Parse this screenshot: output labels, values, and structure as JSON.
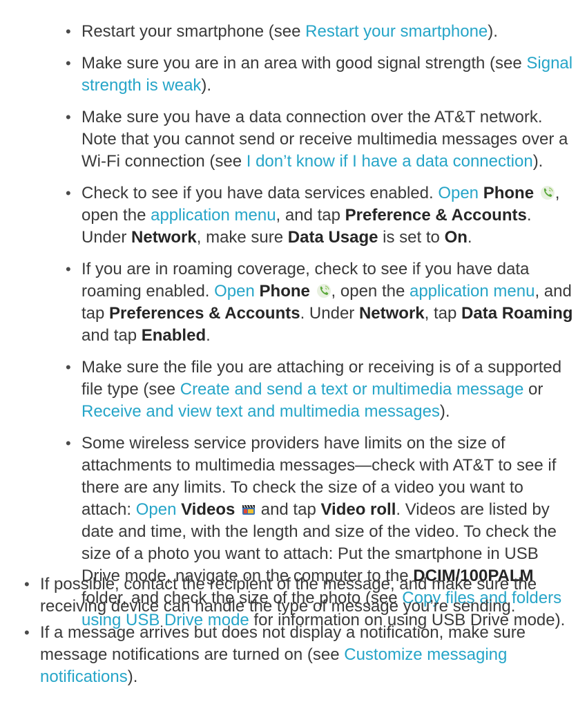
{
  "inner_list": {
    "item1": {
      "t1": "Restart your smartphone (see ",
      "link": "Restart your smartphone",
      "t2": ")."
    },
    "item2": {
      "t1": "Make sure you are in an area with good signal strength (see ",
      "link": "Signal strength is weak",
      "t2": ")."
    },
    "item3": {
      "t1": "Make sure you have a data connection over the AT&T network. Note that you cannot send or receive multimedia messages over a Wi-Fi connection (see ",
      "link": "I don’t know if I have a data connection",
      "t2": ")."
    },
    "item4": {
      "t1": "Check to see if you have data services enabled. ",
      "open": "Open",
      "phone": "Phone",
      "t2": ", open the ",
      "menu": "application menu",
      "t3": ", and tap ",
      "pref": "Preference & Accounts",
      "t4": ". Under ",
      "network": "Network",
      "t5": ", make sure ",
      "usage": "Data Usage",
      "t6": " is set to ",
      "on": "On",
      "t7": "."
    },
    "item5": {
      "t1": "If you are in roaming coverage, check to see if you have data roaming enabled. ",
      "open": "Open",
      "phone": "Phone",
      "t2": ", open the ",
      "menu": "application menu",
      "t3": ", and tap ",
      "pref": "Preferences & Accounts",
      "t4": ". Under ",
      "network": "Network",
      "t5": ", tap ",
      "roaming": "Data Roaming",
      "t6": " and tap ",
      "enabled": "Enabled",
      "t7": "."
    },
    "item6": {
      "t1": "Make sure the file you are attaching or receiving is of a supported file type (see ",
      "link1": "Create and send a text or multimedia message",
      "t2": " or ",
      "link2": "Receive and view text and multimedia messages",
      "t3": ")."
    },
    "item7": {
      "t1": "Some wireless service providers have limits on the size of attachments to multimedia messages—check with AT&T to see if there are any limits. To check the size of a video you want to attach: ",
      "open": "Open",
      "videos": "Videos",
      "t2": " and tap ",
      "roll": "Video roll",
      "t3": ". Videos are listed by date and time, with the length and size of the video. To check the size of a photo you want to attach: Put the smartphone in USB Drive mode, navigate on the computer to the ",
      "folder": "DCIM/100PALM",
      "t4": " folder, and check the size of the photo (see ",
      "link": "Copy files and folders using USB Drive mode",
      "t5": " for information on using USB Drive mode)."
    }
  },
  "outer_list": {
    "item1": {
      "t1": "If possible, contact the recipient of the message, and make sure the receiving device can handle the type of message you’re sending."
    },
    "item2": {
      "t1": "If a message arrives but does not display a notification, make sure message notifications are turned on (see ",
      "link": "Customize messaging notifications",
      "t2": ")."
    }
  },
  "icons": {
    "phone": "phone-app-icon",
    "videos": "videos-app-icon"
  },
  "colors": {
    "link": "#26a5c8",
    "text": "#3a3a3a",
    "bold": "#262626"
  }
}
